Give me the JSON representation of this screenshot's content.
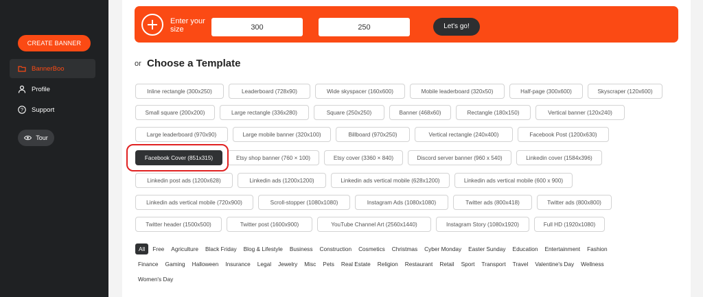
{
  "sidebar": {
    "create_button": "CREATE BANNER",
    "items": [
      {
        "label": "BannerBoo",
        "icon": "folder-icon",
        "active": true
      },
      {
        "label": "Profile",
        "icon": "user-icon",
        "active": false
      },
      {
        "label": "Support",
        "icon": "question-icon",
        "active": false
      }
    ],
    "tour_button": "Tour",
    "accent_color": "#fb4a14"
  },
  "size_bar": {
    "label": "Enter your size",
    "width_value": "300",
    "height_value": "250",
    "separator": "×",
    "go_button": "Let's go!"
  },
  "templates": {
    "or_label": "or",
    "title": "Choose a Template",
    "rows": [
      [
        "Inline rectangle (300x250)",
        "Leaderboard (728x90)",
        "Wide skyspacer (160x600)",
        "Mobile leaderboard (320x50)",
        "Half-page (300x600)",
        "Skyscraper (120x600)"
      ],
      [
        "Small square (200x200)",
        "Large rectangle (336x280)",
        "Square (250x250)",
        "Banner (468x60)",
        "Rectangle (180x150)",
        "Vertical banner (120x240)"
      ],
      [
        "Large leaderboard (970x90)",
        "Large mobile banner (320x100)",
        "Billboard (970x250)",
        "Vertical rectangle (240x400)",
        "Facebook Post (1200x630)"
      ],
      [
        "Facebook Cover (851x315)",
        "Etsy shop banner (760 × 100)",
        "Etsy cover (3360 × 840)",
        "Discord server banner (960 x 540)",
        "Linkedin cover (1584x396)"
      ],
      [
        "Linkedin post ads (1200x628)",
        "Linkedin ads (1200x1200)",
        "Linkedin ads vertical mobile (628x1200)",
        "Linkedin ads vertical mobile (600 x 900)"
      ],
      [
        "Linkedin ads vertical mobile (720x900)",
        "Scroll-stopper (1080x1080)",
        "Instagram Ads (1080x1080)",
        "Twitter ads (800x418)",
        "Twitter ads (800x800)"
      ],
      [
        "Twitter header (1500x500)",
        "Twitter post (1600x900)",
        "YouTube Channel Art (2560x1440)",
        "Instagram Story (1080x1920)",
        "Full HD (1920x1080)"
      ]
    ],
    "selected": "Facebook Cover (851x315)"
  },
  "categories": {
    "rows": [
      [
        "All",
        "Free",
        "Agriculture",
        "Black Friday",
        "Blog & Lifestyle",
        "Business",
        "Construction",
        "Cosmetics",
        "Christmas",
        "Cyber Monday",
        "Easter Sunday",
        "Education",
        "Entertainment",
        "Fashion"
      ],
      [
        "Finance",
        "Gaming",
        "Halloween",
        "Insurance",
        "Legal",
        "Jewelry",
        "Misc",
        "Pets",
        "Real Estate",
        "Religion",
        "Restaurant",
        "Retail",
        "Sport",
        "Transport",
        "Travel",
        "Valentine's Day",
        "Wellness"
      ],
      [
        "Women's Day"
      ]
    ],
    "active": "All"
  }
}
